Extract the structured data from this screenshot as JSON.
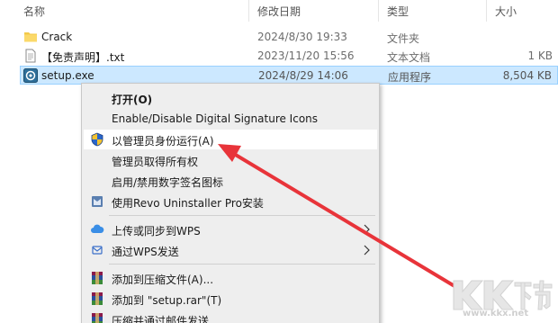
{
  "columns": {
    "name": "名称",
    "date": "修改日期",
    "type": "类型",
    "size": "大小"
  },
  "files": [
    {
      "name": "Crack",
      "date": "2024/8/30 19:33",
      "type": "文件夹",
      "size": "",
      "icon": "folder-icon"
    },
    {
      "name": "【免责声明】.txt",
      "date": "2023/11/20 15:56",
      "type": "文本文档",
      "size": "1 KB",
      "icon": "text-file-icon"
    },
    {
      "name": "setup.exe",
      "date": "2024/8/29 14:06",
      "type": "应用程序",
      "size": "8,504 KB",
      "icon": "setup-app-icon",
      "selected": true
    }
  ],
  "context_menu": {
    "items": [
      {
        "label": "打开(O)",
        "bold": true
      },
      {
        "label": "Enable/Disable Digital Signature Icons"
      },
      {
        "label": "以管理员身份运行(A)",
        "icon": "uac-shield-icon",
        "highlight": true
      },
      {
        "label": "管理员取得所有权"
      },
      {
        "label": "启用/禁用数字签名图标"
      },
      {
        "label": "使用Revo Uninstaller Pro安装",
        "icon": "revo-uninstaller-icon"
      },
      {
        "label": "上传或同步到WPS",
        "icon": "wps-cloud-icon",
        "submenu": true
      },
      {
        "label": "通过WPS发送",
        "icon": "wps-share-icon",
        "submenu": true
      },
      {
        "label": "添加到压缩文件(A)...",
        "icon": "winrar-icon"
      },
      {
        "label": "添加到 \"setup.rar\"(T)",
        "icon": "winrar-icon"
      },
      {
        "label": "压缩并通过邮件发送...",
        "icon": "winrar-icon"
      }
    ]
  },
  "watermark": {
    "logo_text": "KK下载",
    "url": "www.kkx.net"
  },
  "colors": {
    "selection_bg": "#cce8ff",
    "selection_border": "#99d1ff",
    "menu_bg": "#eeeeee",
    "arrow": "#e8343a"
  }
}
